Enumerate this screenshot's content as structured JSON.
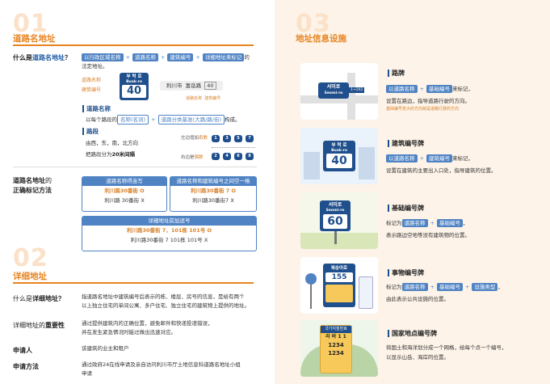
{
  "left": {
    "s01": {
      "num": "01",
      "title": "道路名地址",
      "q_prefix": "什么是",
      "q_bold": "道路名地址",
      "q_suffix": "？",
      "tags": [
        "以行政区域名称",
        "道路名称",
        "建筑编号",
        "详细地址来标记"
      ],
      "tags_tail": "的",
      "line2": "法定地址。",
      "fig_road_label": "道路名称",
      "fig_bldg_label": "建筑编号",
      "fig_sign_ko": "부 락 로",
      "fig_sign_rom": "Buak-ro",
      "fig_sign_num": "40",
      "fig_addr_city": "利川市",
      "fig_addr_road": "富岳路",
      "fig_addr_num": "40",
      "fig_caption_road": "道路名称",
      "fig_caption_bldg": "建筑编号",
      "road_head": "道路名称",
      "road_text_pre": "以每个路段的",
      "road_tag1": "名称(名词)",
      "road_tag2": "道路分类基准(大路/路/街)",
      "road_text_post": "构成。",
      "seg_head": "路段",
      "seg_line1": "由西，东，南，北方向",
      "seg_line2_pre": "把路段分为",
      "seg_line2_bold": "20米间隔",
      "seg_left_label": "左边增加",
      "seg_left_em": "奇数",
      "seg_right_label": "右边是",
      "seg_right_em": "偶数",
      "seg_nums_top": [
        "1",
        "3",
        "5",
        "7"
      ],
      "seg_nums_bottom": [
        "2",
        "4",
        "6",
        "8"
      ]
    },
    "correct": {
      "label_1": "道路名地址",
      "label_1b": "的",
      "label_2": "正确标记方法",
      "box1_head": "道路名称得连写",
      "box1_ok": "利川路30番街",
      "box1_ng": "利川路  30番街",
      "box2_head": "道路名称和建筑编号之间空一格",
      "box2_ok": "利川路30番街  7",
      "box2_ng": "利川路30番街7",
      "box3_head": "详细地址前加逗号",
      "box3_ok": "利川路30番街  7，101栋 101号",
      "box3_ng": "利川路30番街  7 101栋 101号",
      "ok_mark": "O",
      "ng_mark": "X"
    },
    "s02": {
      "num": "02",
      "title": "详细地址",
      "rows": [
        {
          "label_pre": "什么是",
          "label_bold": "详细地址",
          "label_post": "？",
          "line1": "指道路名地址中建筑编号后表示的栋、楼层、房号的信息，是给有两个",
          "line2": "以上独立住宅的单间公寓、多户住宅、独立住宅的建筑物上提供的地址。"
        },
        {
          "label_pre": "详细地址的",
          "label_bold": "重要性",
          "label_post": "",
          "line1": "通过提供建筑内的正确位置，避免邮件和快递投递错误，",
          "line2": "并在发生紧急情况时能过做出迅速对应。"
        },
        {
          "label_pre": "",
          "label_bold": "申请人",
          "label_post": "",
          "line1": "该建筑的业主和租户",
          "line2": ""
        },
        {
          "label_pre": "",
          "label_bold": "申请方法",
          "label_post": "",
          "line1": "通过政府24在线申请及亲自访问利川市厅土地信息科道路名地址小组",
          "line2": "申请"
        }
      ]
    }
  },
  "right": {
    "num": "03",
    "title": "地址信息设施",
    "items": [
      {
        "head": "路牌",
        "tags": [
          "以道路名称",
          "基础编号"
        ],
        "tail": "来标记，",
        "line2": "设置在路边，指导道路行驶的方向。",
        "note": "基础编号变大的方向就是道路行驶的方向",
        "sign_ko": "서미로",
        "sign_rom": "Seomi-ro",
        "sign_sub": "1→102"
      },
      {
        "head": "建筑编号牌",
        "tags": [
          "以道路名称",
          "建筑编号"
        ],
        "tail": "来标记，",
        "line2": "设置在建筑的主要出入口处，指导建筑的位置。",
        "note": "",
        "sign_ko": "부 락 로",
        "sign_rom": "Buak-ro",
        "sign_sub": "40"
      },
      {
        "head": "基础编号牌",
        "tags": [
          "道路名称",
          "基础编号"
        ],
        "tail": "，",
        "pre": "标记为",
        "line2": "表示路边空地等没有建筑物的位置。",
        "note": "",
        "sign_ko": "서미로",
        "sign_rom": "Seomi-ro",
        "sign_sub": "60"
      },
      {
        "head": "事物编号牌",
        "tags": [
          "道路名称",
          "基础编号",
          "设施类型"
        ],
        "tail": "，",
        "pre": "标记为",
        "line2": "由此表示公共设施的位置。",
        "note": "",
        "sign_ko": "복숭아로",
        "sign_rom": "",
        "sign_sub": "155"
      },
      {
        "head": "国家地点编号牌",
        "tags": [],
        "tail": "",
        "line1": "将国土和海洋划分成一个网格，给每个点一个编号，",
        "line2": "以显示山岳、海岸的位置。",
        "note": "",
        "sign_ko": "국가지점번호",
        "sign_rom": "라 바 1 1",
        "sign_sub": "1234"
      }
    ]
  }
}
